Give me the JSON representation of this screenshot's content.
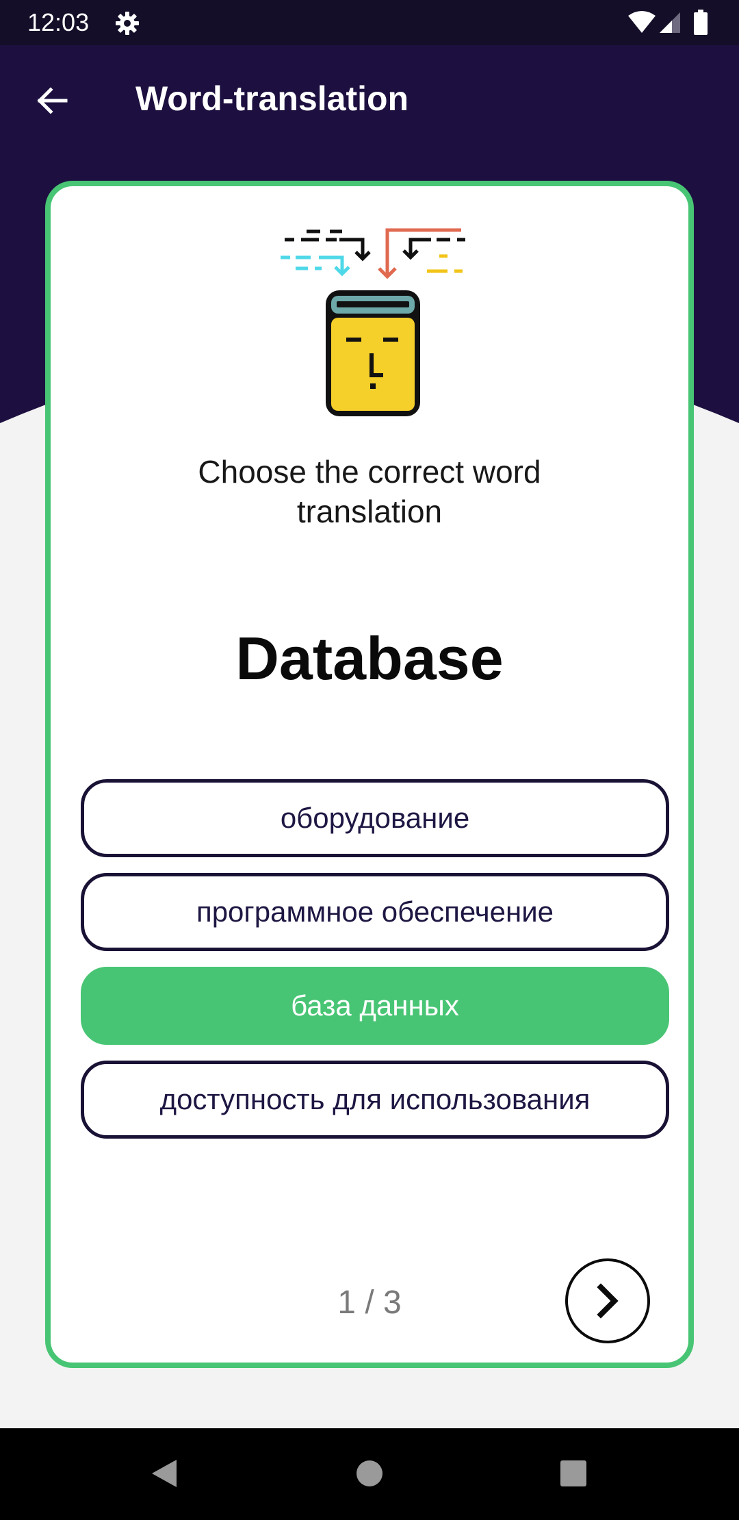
{
  "status_bar": {
    "time": "12:03",
    "settings_icon": "gear-icon",
    "wifi_icon": "wifi-icon",
    "signal_icon": "signal-icon",
    "battery_icon": "battery-icon"
  },
  "app_bar": {
    "title": "Word-translation",
    "back_icon": "arrow-back-icon"
  },
  "quiz": {
    "instruction": "Choose the correct word translation",
    "word": "Database",
    "options": [
      {
        "label": "оборудование",
        "state": "default"
      },
      {
        "label": "программное обеспечение",
        "state": "default"
      },
      {
        "label": "база данных",
        "state": "correct"
      },
      {
        "label": "доступность для использования",
        "state": "default"
      }
    ],
    "progress": "1 / 3",
    "next_icon": "chevron-right-icon"
  },
  "nav_bar": {
    "back_icon": "nav-back-icon",
    "home_icon": "nav-home-icon",
    "recents_icon": "nav-recents-icon"
  },
  "colors": {
    "header_background": "#1d1040",
    "status_bar_background": "#140e28",
    "accent_green": "#48c574",
    "option_border": "#1a1235",
    "page_background": "#f3f3f3",
    "card_background": "#ffffff"
  }
}
